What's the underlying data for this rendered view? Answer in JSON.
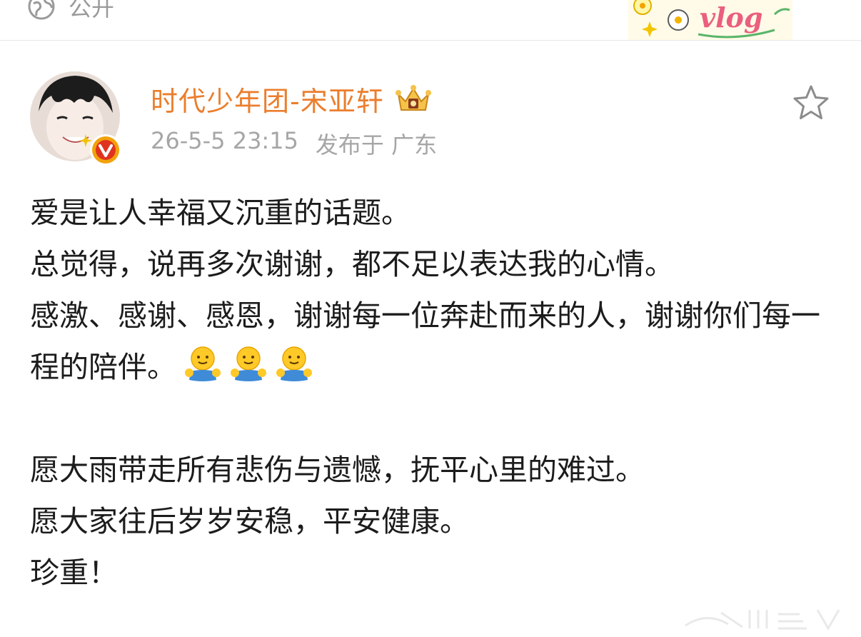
{
  "header": {
    "visibility_label": "公开",
    "sticker_text": "vlog"
  },
  "post": {
    "author": "时代少年团-宋亚轩",
    "timestamp": "26-5-5 23:15",
    "location": "发布于 广东",
    "paragraphs": [
      "爱是让人幸福又沉重的话题。",
      "总觉得，说再多次谢谢，都不足以表达我的心情。",
      "感激、感谢、感恩，谢谢每一位奔赴而来的人，谢谢你们每一程的陪伴。",
      "愿大雨带走所有悲伤与遗憾，抚平心里的难过。",
      "愿大家往后岁岁安稳，平安健康。",
      "珍重！"
    ],
    "emoji_count": 3
  },
  "colors": {
    "author_name": "#eb7e2d",
    "meta_text": "#a6a6a6",
    "verified_badge": "#f2a20b",
    "divider": "#e8e8e8"
  },
  "icons": {
    "visibility": "globe-icon",
    "verified": "verified-badge-icon",
    "member": "crown-icon",
    "favorite": "star-icon",
    "emoji": "hug-emoji-icon"
  }
}
